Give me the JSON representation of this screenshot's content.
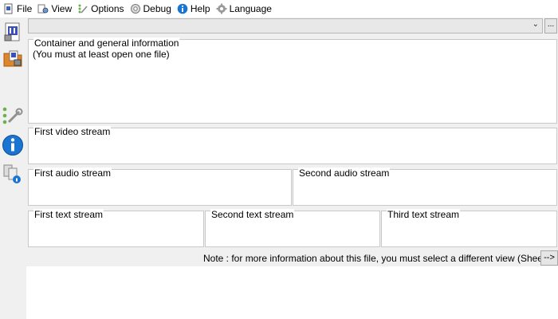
{
  "menu": {
    "items": [
      {
        "label": "File",
        "icon": "file-icon"
      },
      {
        "label": "View",
        "icon": "view-icon"
      },
      {
        "label": "Options",
        "icon": "options-icon"
      },
      {
        "label": "Debug",
        "icon": "debug-icon"
      },
      {
        "label": "Help",
        "icon": "help-icon"
      },
      {
        "label": "Language",
        "icon": "language-icon"
      }
    ]
  },
  "toolbar": {
    "icons": [
      "open-file-icon",
      "open-folder-icon",
      "preferences-icon",
      "about-icon",
      "knowledge-icon"
    ]
  },
  "file_select": {
    "value": "",
    "browse_label": "..."
  },
  "panels": {
    "general": {
      "title": "Container and general information",
      "body": "(You must at least open one file)"
    },
    "video1": {
      "title": "First video stream"
    },
    "audio1": {
      "title": "First audio stream"
    },
    "audio2": {
      "title": "Second audio stream"
    },
    "text1": {
      "title": "First text stream"
    },
    "text2": {
      "title": "Second text stream"
    },
    "text3": {
      "title": "Third text stream"
    }
  },
  "note": {
    "text": "Note : for more information about this file, you must select a different view (Sheet, Tree...)",
    "button_label": "-->"
  },
  "colors": {
    "accent_blue": "#1a74d2",
    "toolbar_bg": "#f0f0f0",
    "panel_border": "#c9c9c9"
  }
}
